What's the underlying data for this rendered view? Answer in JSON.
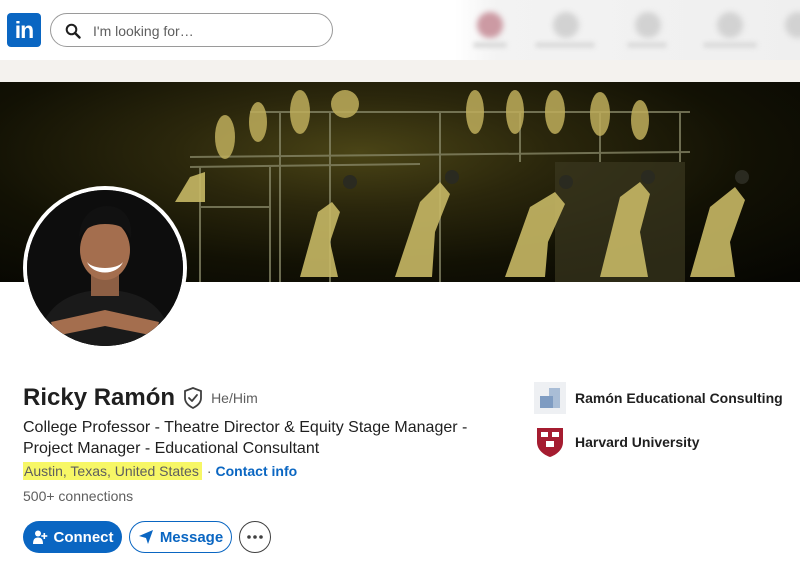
{
  "nav": {
    "logo_text": "in",
    "search_placeholder": "I'm looking for…"
  },
  "profile": {
    "name": "Ricky Ramón",
    "pronouns": "He/Him",
    "headline": "College Professor - Theatre Director & Equity Stage Manager - Project Manager - Educational Consultant",
    "location": "Austin, Texas, United States",
    "separator": "·",
    "contact_info": "Contact info",
    "connections": "500+ connections"
  },
  "actions": {
    "connect_label": "Connect",
    "message_label": "Message"
  },
  "organizations": [
    {
      "name": "Ramón Educational Consulting",
      "icon": "company-logo-icon"
    },
    {
      "name": "Harvard University",
      "icon": "harvard-shield-icon"
    }
  ],
  "colors": {
    "brand": "#0a66c2",
    "highlight": "#f7f766",
    "text_secondary": "#5e5e5e"
  }
}
